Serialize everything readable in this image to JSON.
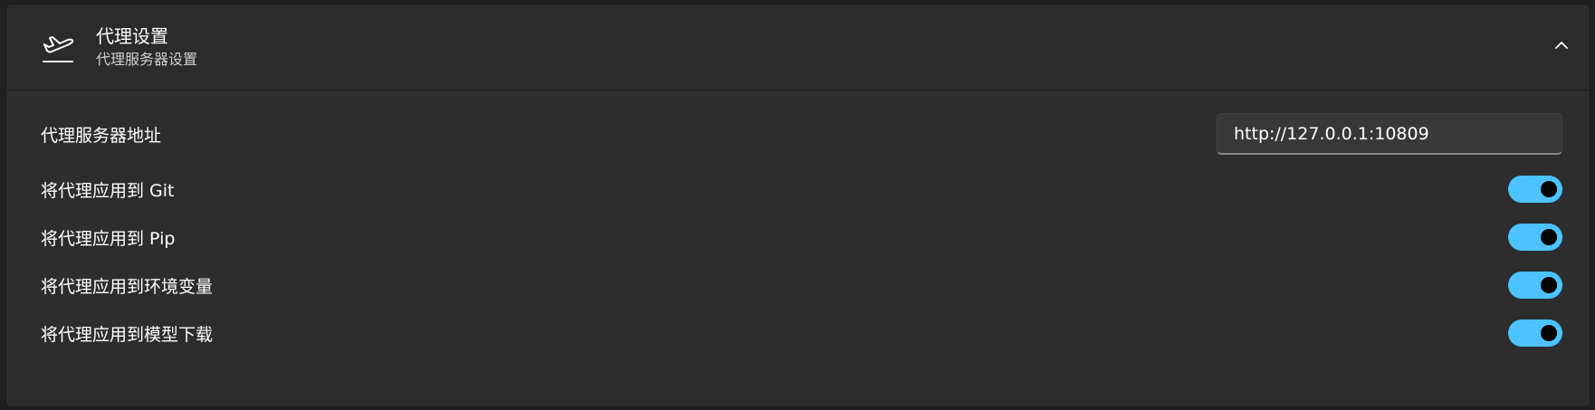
{
  "header": {
    "title": "代理设置",
    "subtitle": "代理服务器设置",
    "icon": "airplane-takeoff-icon",
    "chevron": "chevron-up-icon"
  },
  "proxy_address": {
    "label": "代理服务器地址",
    "value": "http://127.0.0.1:10809"
  },
  "toggles": [
    {
      "label": "将代理应用到 Git",
      "on": true
    },
    {
      "label": "将代理应用到 Pip",
      "on": true
    },
    {
      "label": "将代理应用到环境变量",
      "on": true
    },
    {
      "label": "将代理应用到模型下载",
      "on": true
    }
  ],
  "colors": {
    "accent": "#4cc2ff",
    "background": "#2b2b2b",
    "knob": "#000000"
  }
}
